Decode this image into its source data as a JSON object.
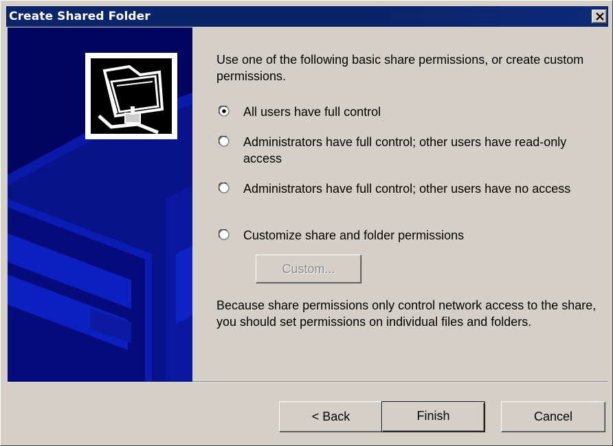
{
  "window": {
    "title": "Create Shared Folder",
    "close_icon": "close-icon"
  },
  "side_panel": {
    "icon": "shared-folder-network-icon",
    "background_color": "#020560"
  },
  "main": {
    "intro": "Use one of the following basic share permissions, or create custom permissions.",
    "options": [
      {
        "label": "All users have full control",
        "selected": true
      },
      {
        "label": "Administrators have full control; other users have read-only access",
        "selected": false
      },
      {
        "label": "Administrators have full control; other users have no access",
        "selected": false
      },
      {
        "label": "Customize share and folder permissions",
        "selected": false
      }
    ],
    "custom_button": "Custom...",
    "note": "Because share permissions only control network access to the share, you should set permissions on individual files and folders."
  },
  "footer": {
    "back_label": "< Back",
    "finish_label": "Finish",
    "cancel_label": "Cancel"
  },
  "colors": {
    "titlebar": "#0a246a",
    "dialog_face": "#d4d0c8"
  }
}
